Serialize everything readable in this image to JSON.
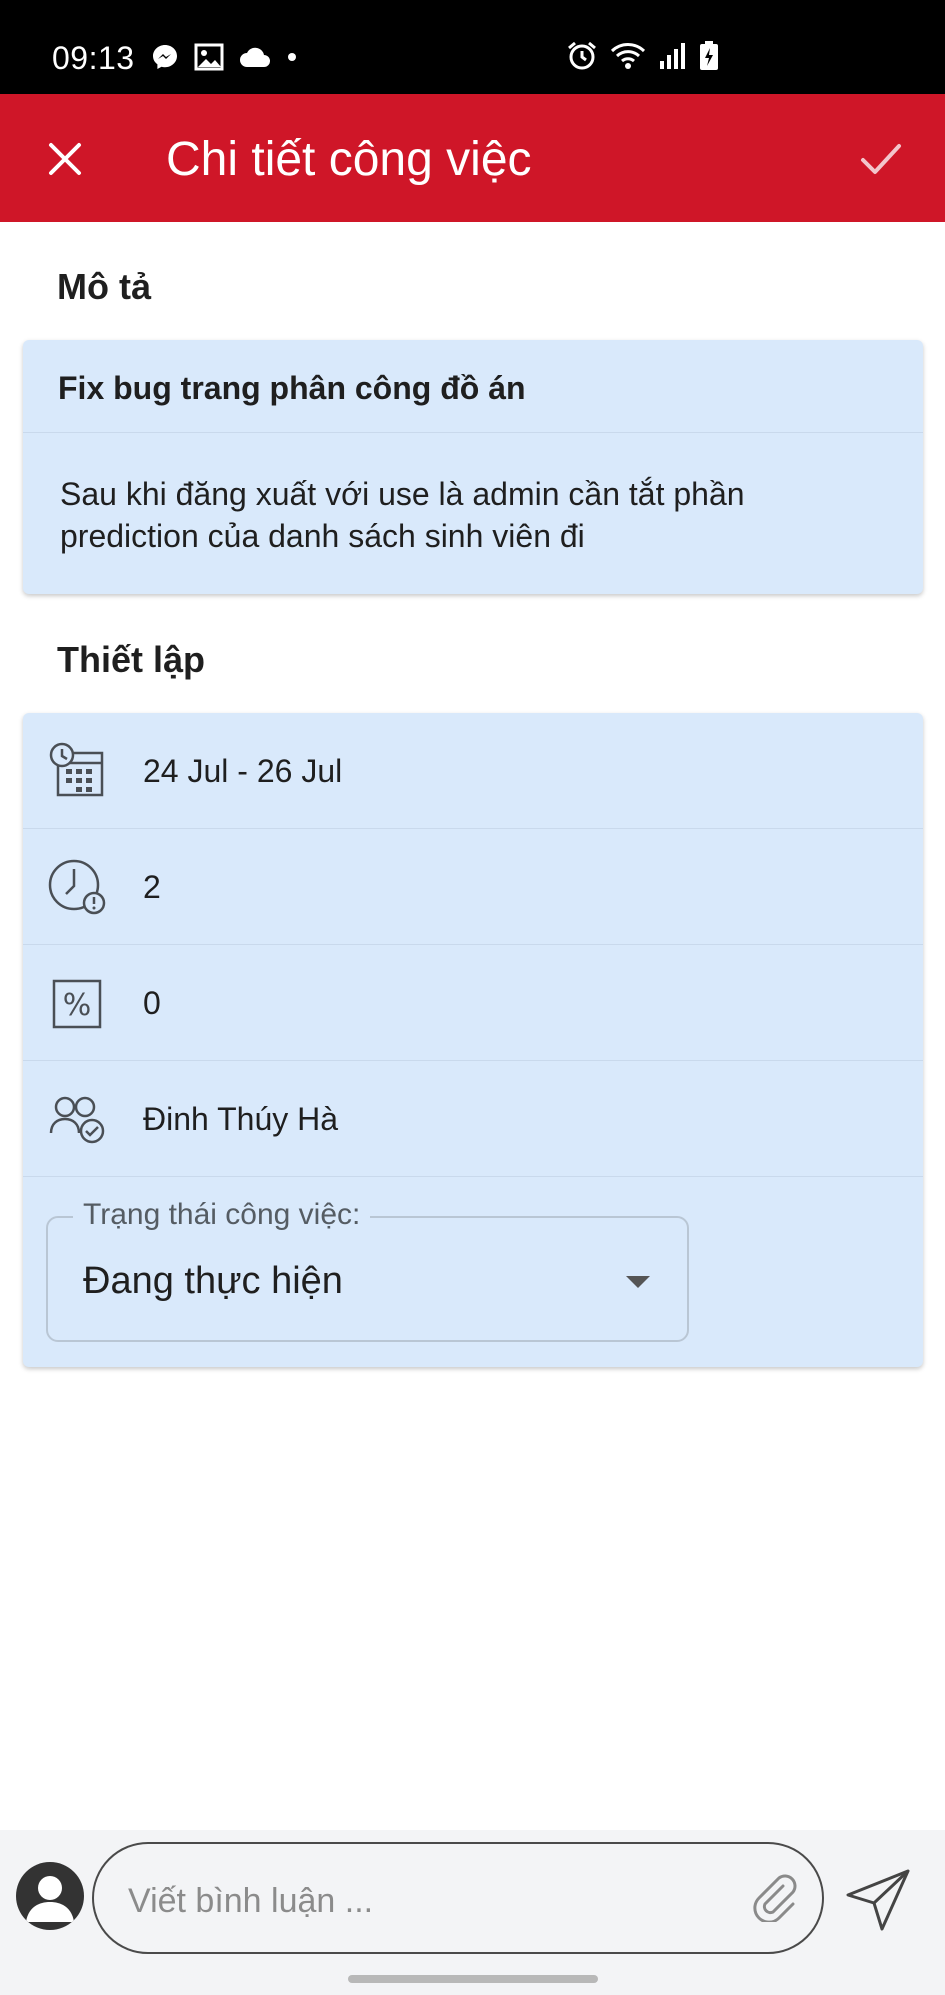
{
  "status_bar": {
    "time": "09:13",
    "left_icons": [
      "messenger-icon",
      "gallery-icon",
      "cloud-icon",
      "dot-icon"
    ],
    "right_icons": [
      "alarm-icon",
      "wifi-icon",
      "signal-icon",
      "battery-charging-icon"
    ]
  },
  "app_bar": {
    "title": "Chi tiết công việc",
    "close_icon": "close-icon",
    "confirm_icon": "check-icon",
    "color": "#cf1628"
  },
  "description": {
    "section_label": "Mô tả",
    "title": "Fix bug trang phân công đồ án",
    "body": "Sau khi đăng xuất với use là admin cần tắt phần prediction của danh sách sinh viên đi"
  },
  "settings": {
    "section_label": "Thiết lập",
    "rows": [
      {
        "icon": "calendar-clock-icon",
        "value": "24 Jul - 26 Jul"
      },
      {
        "icon": "clock-alert-icon",
        "value": "2"
      },
      {
        "icon": "percent-icon",
        "value": "0"
      },
      {
        "icon": "assignee-icon",
        "value": "Đinh Thúy Hà"
      }
    ],
    "status_label": "Trạng thái công việc:",
    "status_value": "Đang thực hiện",
    "card_color": "#d9e9fb"
  },
  "comment": {
    "placeholder": "Viết bình luận ...",
    "attach_icon": "paperclip-icon",
    "send_icon": "send-icon",
    "avatar_icon": "user-avatar-icon"
  }
}
